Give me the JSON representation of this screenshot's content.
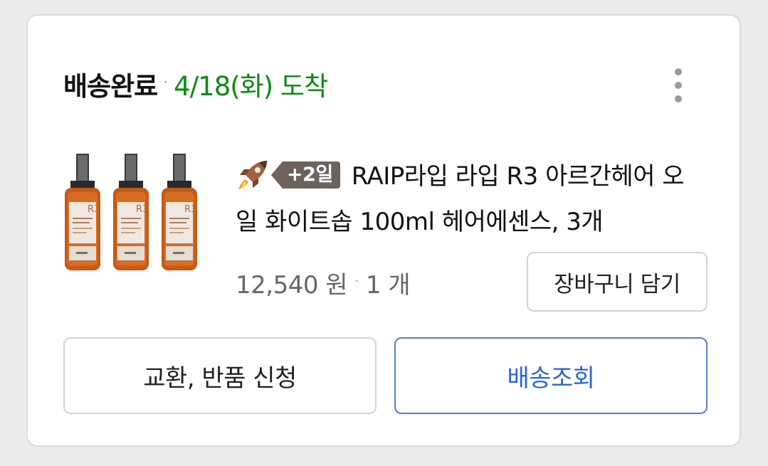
{
  "order": {
    "status": "배송완료",
    "separator": "·",
    "arrival": "4/18(화) 도착",
    "more_icon": "more-vertical-icon"
  },
  "product": {
    "rocket_icon": "rocket-icon",
    "badge": "+2일",
    "title": "RAIP라입 라입 R3 아르간헤어 오일 화이트솝 100ml 헤어에센스, 3개",
    "price": "12,540 원",
    "separator": "·",
    "quantity": "1 개",
    "bottle_label": "R3"
  },
  "buttons": {
    "cart": "장바구니 담기",
    "return": "교환, 반품 신청",
    "track": "배송조회"
  },
  "colors": {
    "arrival": "#0d8a16",
    "badge": "#6e625c",
    "track_accent": "#2d66d3"
  }
}
